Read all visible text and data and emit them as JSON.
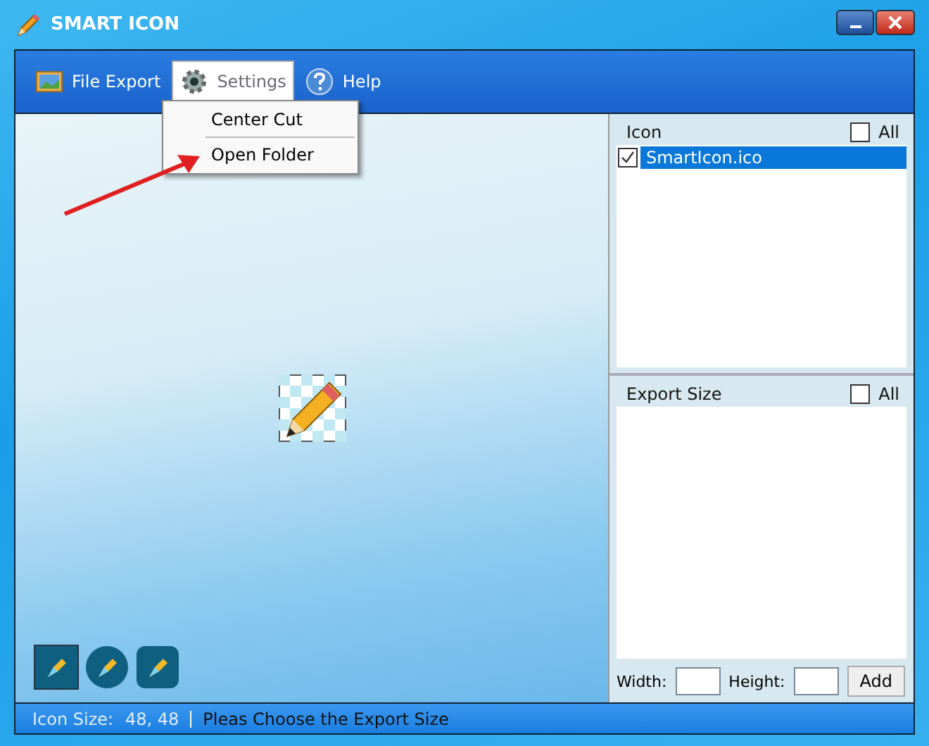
{
  "window": {
    "title": "SMART ICON"
  },
  "toolbar": [
    {
      "label": "File Export",
      "kind": "export",
      "selected": false
    },
    {
      "label": "Settings",
      "kind": "settings",
      "selected": true
    },
    {
      "label": "Help",
      "kind": "help",
      "selected": false
    }
  ],
  "menu": [
    {
      "label": "Center Cut"
    },
    {
      "label": "Open Folder"
    }
  ],
  "shape_buttons": [
    {
      "kind": "square",
      "selected": true
    },
    {
      "kind": "circle",
      "selected": false
    },
    {
      "kind": "rounded",
      "selected": false
    }
  ],
  "icon_panel": {
    "title": "Icon",
    "all_label": "All",
    "all_checked": false,
    "items": [
      {
        "label": "SmartIcon.ico",
        "checked": true,
        "selected": true
      }
    ]
  },
  "export_panel": {
    "title": "Export Size",
    "all_label": "All",
    "all_checked": false,
    "width_label": "Width:",
    "height_label": "Height:",
    "add_button": "Add"
  },
  "status_bar": {
    "size_label": "Icon Size:",
    "size_value": "48, 48",
    "message": "Pleas Choose the Export Size"
  }
}
